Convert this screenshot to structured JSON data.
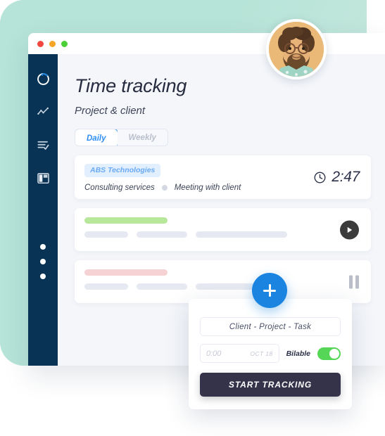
{
  "backdrop": {
    "color": "#b7e4d8"
  },
  "window": {
    "traffic_lights": [
      {
        "name": "close",
        "color": "#f3483f"
      },
      {
        "name": "minimize",
        "color": "#f6a525"
      },
      {
        "name": "maximize",
        "color": "#4cd037"
      }
    ]
  },
  "sidebar": {
    "background": "#083354",
    "items": [
      {
        "icon": "timer-circle-icon",
        "active": true
      },
      {
        "icon": "analytics-chart-icon",
        "active": false
      },
      {
        "icon": "task-list-check-icon",
        "active": false
      },
      {
        "icon": "dashboard-layout-icon",
        "active": false
      }
    ],
    "dots": [
      1,
      2,
      3
    ]
  },
  "header": {
    "title": "Time tracking",
    "subtitle": "Project & client"
  },
  "tabs": [
    {
      "label": "Daily",
      "active": true
    },
    {
      "label": "Weekly",
      "active": false
    }
  ],
  "entries": [
    {
      "type": "detailed",
      "badge": "ABS Technologies",
      "badge_color": "#6aaaf3",
      "service": "Consulting services",
      "task": "Meeting with client",
      "duration": "2:47",
      "clock_icon": "clock-icon"
    },
    {
      "type": "skeleton",
      "accent_color": "#b7e79b",
      "action_icon": "play-icon"
    },
    {
      "type": "skeleton",
      "accent_color": "#f7d2d4",
      "action_icon": "pause-icon"
    }
  ],
  "fab": {
    "icon": "plus-icon",
    "color": "#1a84e0"
  },
  "popup": {
    "selector_placeholder": "Client  -  Project  -  Task",
    "time_value": "0:00",
    "date_value": "OCT 18",
    "billable_label": "Bilable",
    "billable_on": true,
    "toggle_color": "#56d656",
    "start_label": "START TRACKING"
  },
  "avatar": {
    "alt": "user-avatar"
  }
}
